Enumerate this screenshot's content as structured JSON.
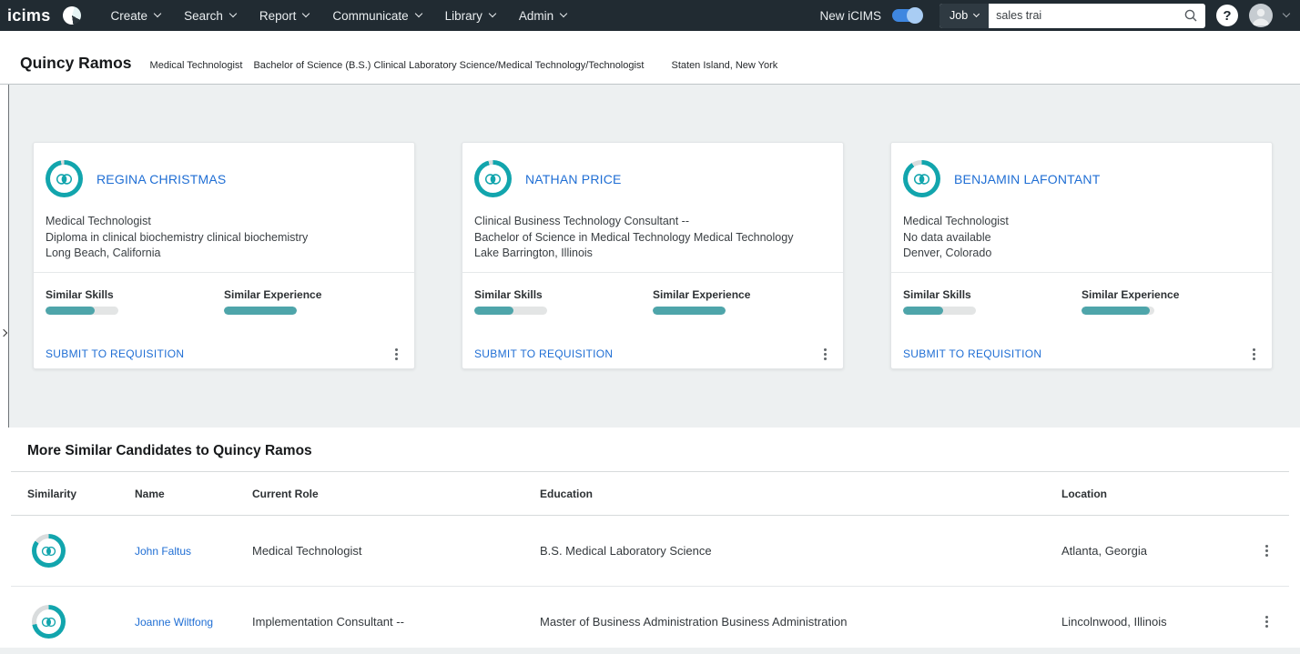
{
  "topbar": {
    "logo": "icims",
    "menus": [
      {
        "label": "Create"
      },
      {
        "label": "Search"
      },
      {
        "label": "Report"
      },
      {
        "label": "Communicate"
      },
      {
        "label": "Library"
      },
      {
        "label": "Admin"
      }
    ],
    "new_icims_label": "New iCIMS",
    "search": {
      "scope": "Job",
      "value": "sales trai"
    },
    "help_label": "?"
  },
  "header": {
    "name": "Quincy Ramos",
    "role": "Medical Technologist",
    "education": "Bachelor of Science (B.S.) Clinical Laboratory Science/Medical Technology/Technologist",
    "location": "Staten Island, New York"
  },
  "labels": {
    "skills": "Similar Skills",
    "experience": "Similar Experience",
    "submit": "SUBMIT TO REQUISITION"
  },
  "cards": [
    {
      "name": "REGINA CHRISTMAS",
      "role": "Medical Technologist",
      "education": "Diploma in clinical biochemistry clinical biochemistry",
      "location": "Long Beach, California",
      "similarity_pct": 97,
      "skills_pct": 67,
      "experience_pct": 100
    },
    {
      "name": "NATHAN PRICE",
      "role": "Clinical Business Technology Consultant --",
      "education": "Bachelor of Science in Medical Technology Medical Technology",
      "location": "Lake Barrington, Illinois",
      "similarity_pct": 96,
      "skills_pct": 54,
      "experience_pct": 100
    },
    {
      "name": "BENJAMIN LAFONTANT",
      "role": "Medical Technologist",
      "education": "No data available",
      "location": "Denver, Colorado",
      "similarity_pct": 91,
      "skills_pct": 55,
      "experience_pct": 94
    }
  ],
  "table": {
    "title": "More Similar Candidates to Quincy Ramos",
    "columns": [
      "Similarity",
      "Name",
      "Current Role",
      "Education",
      "Location"
    ],
    "rows": [
      {
        "name": "John Faltus",
        "current_role": "Medical Technologist",
        "education": "B.S. Medical Laboratory Science",
        "location": "Atlanta, Georgia",
        "similarity_pct": 85
      },
      {
        "name": "Joanne Wiltfong",
        "current_role": "Implementation Consultant --",
        "education": "Master of Business Administration Business Administration",
        "location": "Lincolnwood, Illinois",
        "similarity_pct": 72
      }
    ]
  },
  "colors": {
    "topbar_bg": "#212b32",
    "teal": "#12a5ad",
    "bar_teal": "#4ea5aa",
    "link_blue": "#1f6ed4",
    "toggle_blue": "#3f87e0",
    "toggle_knob": "#a9cdf4"
  }
}
